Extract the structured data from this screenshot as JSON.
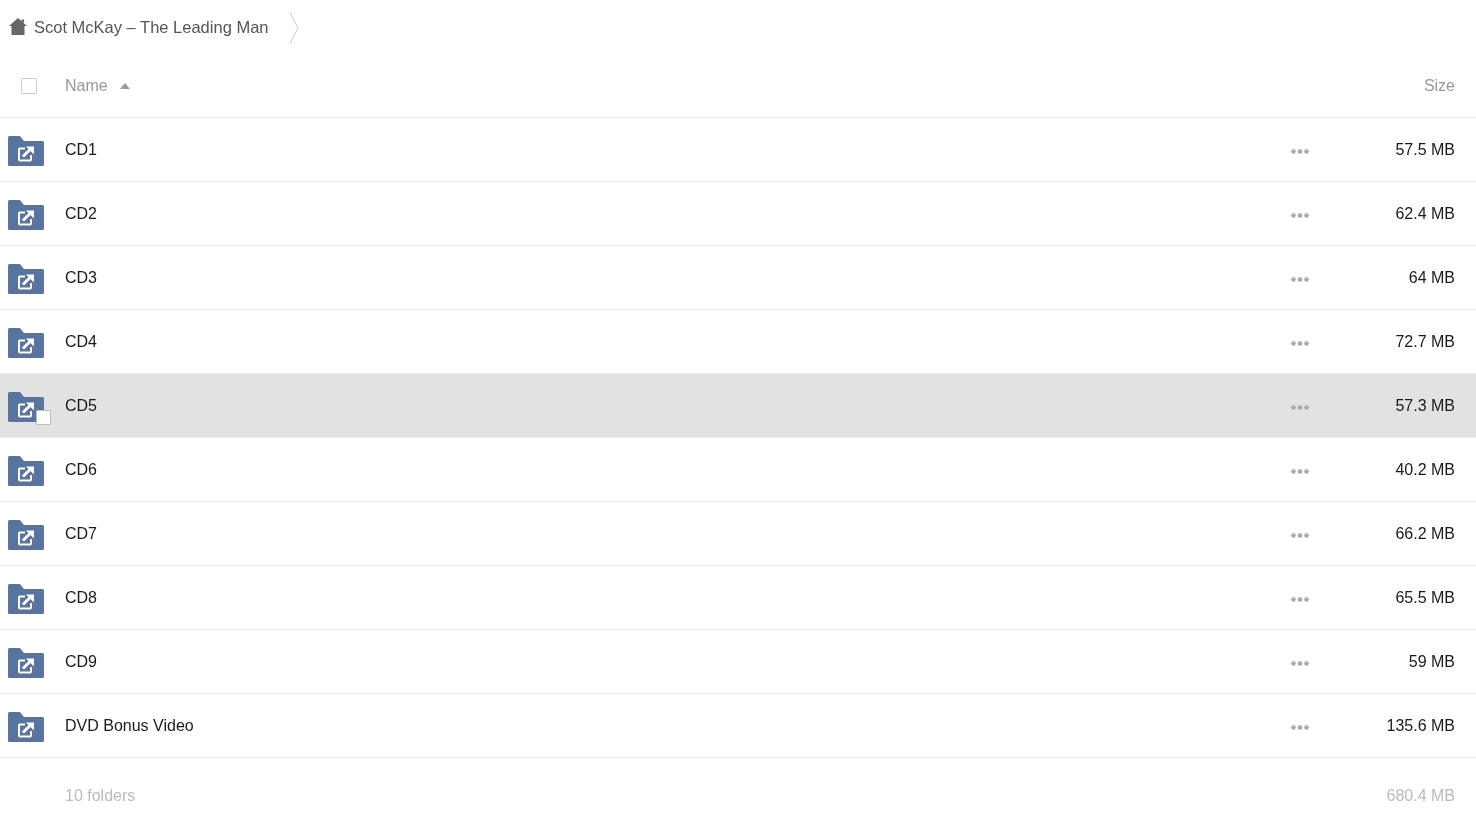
{
  "breadcrumb": {
    "title": "Scot McKay – The Leading Man"
  },
  "table": {
    "select_all": {
      "checked": false
    },
    "columns": [
      {
        "label": "Name",
        "sorted": true,
        "ascending": true
      },
      {
        "label": "Size",
        "sorted": false
      }
    ],
    "rows": [
      {
        "name": "CD1",
        "size": "57.5 MB",
        "hovered": false,
        "checked": false
      },
      {
        "name": "CD2",
        "size": "62.4 MB",
        "hovered": false,
        "checked": false
      },
      {
        "name": "CD3",
        "size": "64 MB",
        "hovered": false,
        "checked": false
      },
      {
        "name": "CD4",
        "size": "72.7 MB",
        "hovered": false,
        "checked": false
      },
      {
        "name": "CD5",
        "size": "57.3 MB",
        "hovered": true,
        "checked": false
      },
      {
        "name": "CD6",
        "size": "40.2 MB",
        "hovered": false,
        "checked": false
      },
      {
        "name": "CD7",
        "size": "66.2 MB",
        "hovered": false,
        "checked": false
      },
      {
        "name": "CD8",
        "size": "65.5 MB",
        "hovered": false,
        "checked": false
      },
      {
        "name": "CD9",
        "size": "59 MB",
        "hovered": false,
        "checked": false
      },
      {
        "name": "DVD Bonus Video",
        "size": "135.6 MB",
        "hovered": false,
        "checked": false
      }
    ]
  },
  "footer": {
    "count": "10 folders",
    "total": "680.4 MB"
  }
}
